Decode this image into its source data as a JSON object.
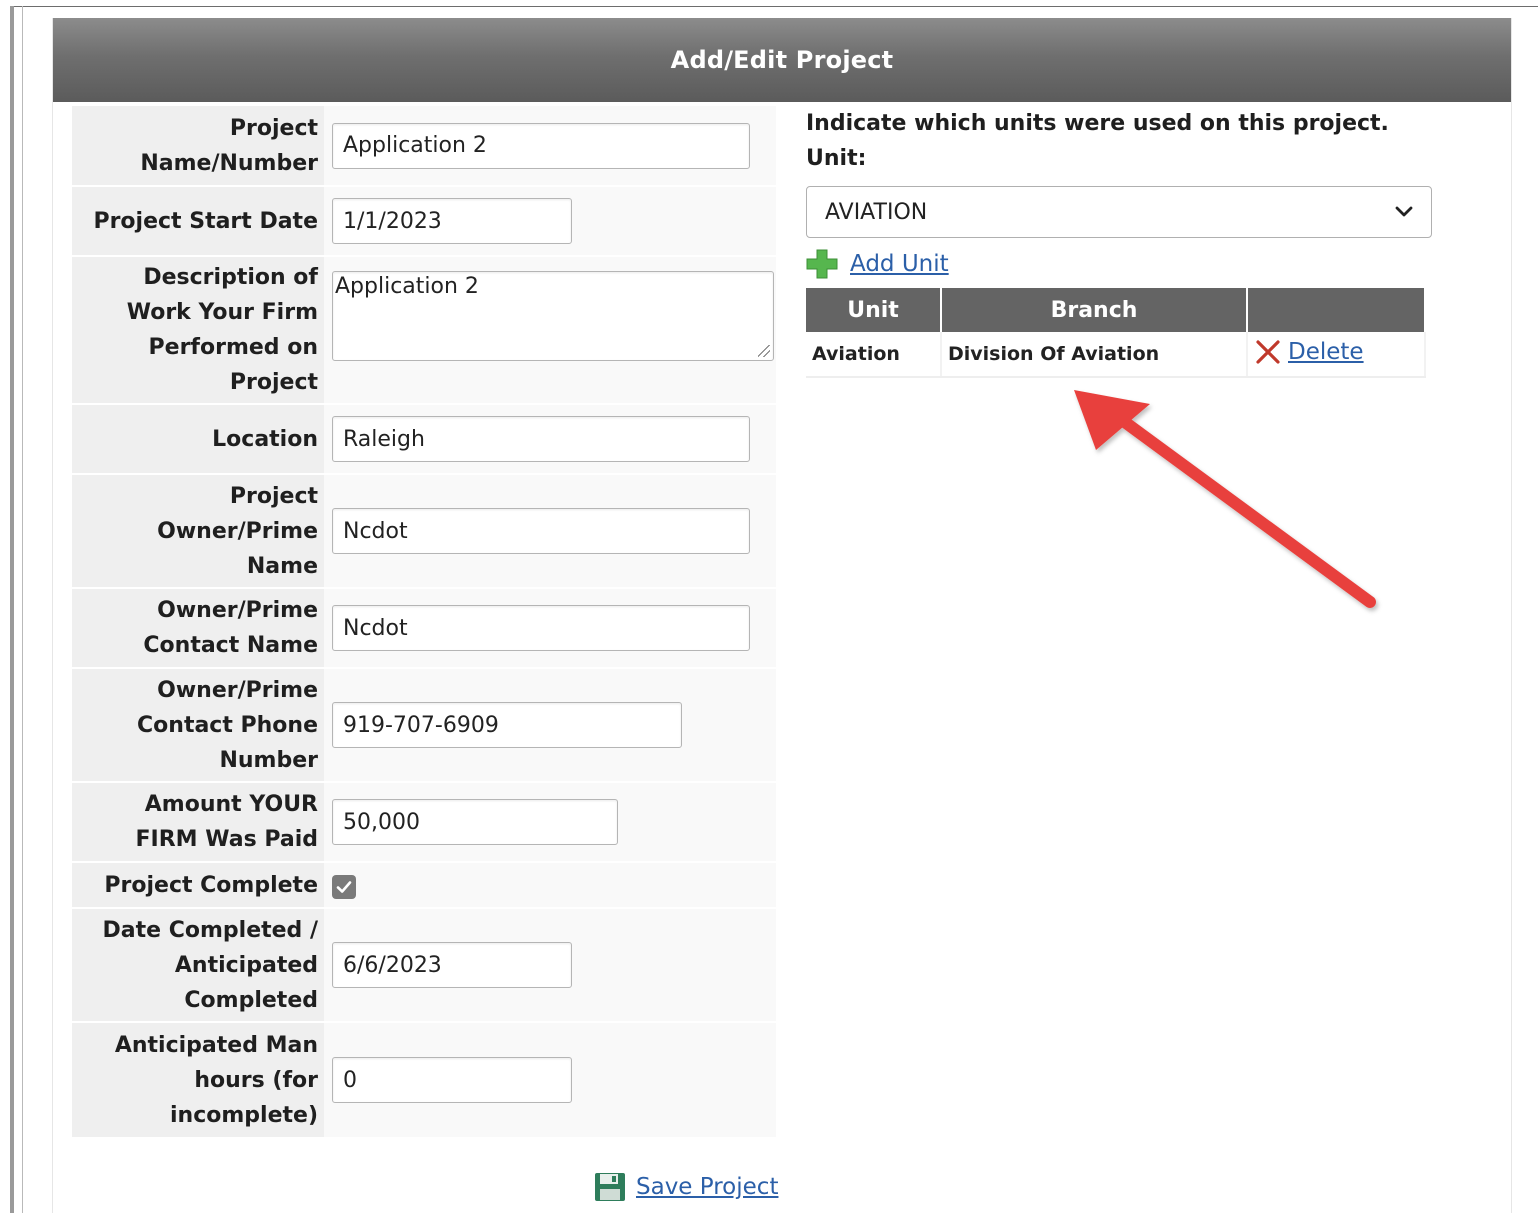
{
  "panel": {
    "title": "Add/Edit Project"
  },
  "form": {
    "project_name": {
      "label": "Project Name/Number",
      "label_lines": [
        "Project",
        "Name/Number"
      ],
      "value": "Application 2"
    },
    "start_date": {
      "label": "Project Start Date",
      "value": "1/1/2023"
    },
    "description": {
      "label_lines": [
        "Description of",
        "Work Your Firm",
        "Performed on",
        "Project"
      ],
      "value": "Application 2"
    },
    "location": {
      "label": "Location",
      "value": "Raleigh"
    },
    "owner_name": {
      "label_lines": [
        "Project",
        "Owner/Prime",
        "Name"
      ],
      "value": "Ncdot"
    },
    "contact_name": {
      "label_lines": [
        "Owner/Prime",
        "Contact Name"
      ],
      "value": "Ncdot"
    },
    "contact_phone": {
      "label_lines": [
        "Owner/Prime",
        "Contact Phone",
        "Number"
      ],
      "value": "919-707-6909"
    },
    "amount_paid": {
      "label_lines": [
        "Amount YOUR",
        "FIRM Was Paid"
      ],
      "value": "50,000"
    },
    "project_complete": {
      "label": "Project Complete",
      "checked": true
    },
    "date_completed": {
      "label_lines": [
        "Date Completed /",
        "Anticipated",
        "Completed"
      ],
      "value": "6/6/2023"
    },
    "man_hours": {
      "label_lines": [
        "Anticipated Man",
        "hours (for",
        "incomplete)"
      ],
      "value": "0"
    },
    "save_label": "Save Project"
  },
  "units": {
    "instruction": "Indicate which units were used on this project.",
    "unit_label": "Unit:",
    "selected_unit": "AVIATION",
    "add_label": "Add Unit",
    "table": {
      "headers": [
        "Unit",
        "Branch",
        ""
      ],
      "rows": [
        {
          "unit": "Aviation",
          "branch": "Division Of Aviation",
          "action": "Delete"
        }
      ]
    }
  },
  "colors": {
    "header_bg": "#6f6f6f",
    "link": "#2b5fa8",
    "annotation_arrow": "#e8413c",
    "delete_icon": "#c0392b",
    "add_icon": "#4caf50"
  }
}
